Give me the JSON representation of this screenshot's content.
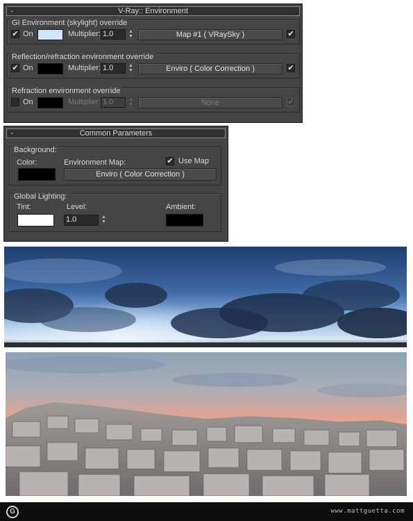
{
  "environment_rollout": {
    "title": "V-Ray:: Environment",
    "collapse_symbol": "-",
    "gi_override": {
      "title": "GI Environment (skylight) override",
      "on_label": "On",
      "on_checked": true,
      "color": "#cfe4ff",
      "multiplier_label": "Multiplier:",
      "multiplier_value": "1.0",
      "map_label": "Map #1  ( VRaySky )",
      "map_enabled": true
    },
    "reflection_override": {
      "title": "Reflection/refraction environment override",
      "on_label": "On",
      "on_checked": true,
      "color": "#000000",
      "multiplier_label": "Multiplier:",
      "multiplier_value": "1.0",
      "map_label": "Enviro  ( Color Correction )",
      "map_enabled": true
    },
    "refraction_override": {
      "title": "Refraction environment override",
      "on_label": "On",
      "on_checked": false,
      "color": "#000000",
      "multiplier_label": "Multiplier:",
      "multiplier_value": "1.0",
      "map_label": "None",
      "map_enabled": true
    }
  },
  "common_rollout": {
    "title": "Common Parameters",
    "collapse_symbol": "-",
    "background": {
      "title": "Background:",
      "color_label": "Color:",
      "color": "#000000",
      "env_map_label": "Environment Map:",
      "use_map_label": "Use Map",
      "use_map_checked": true,
      "map_label": "Enviro  ( Color Correction )"
    },
    "global_lighting": {
      "title": "Global Lighting:",
      "tint_label": "Tint:",
      "tint_color": "#ffffff",
      "level_label": "Level:",
      "level_value": "1.0",
      "ambient_label": "Ambient:",
      "ambient_color": "#000000"
    }
  },
  "icons": {
    "checkmark": "✔",
    "spinner_up": "▲",
    "spinner_down": "▼"
  },
  "footer": {
    "logo_letter": "G",
    "url": "www.mattguetta.com"
  }
}
